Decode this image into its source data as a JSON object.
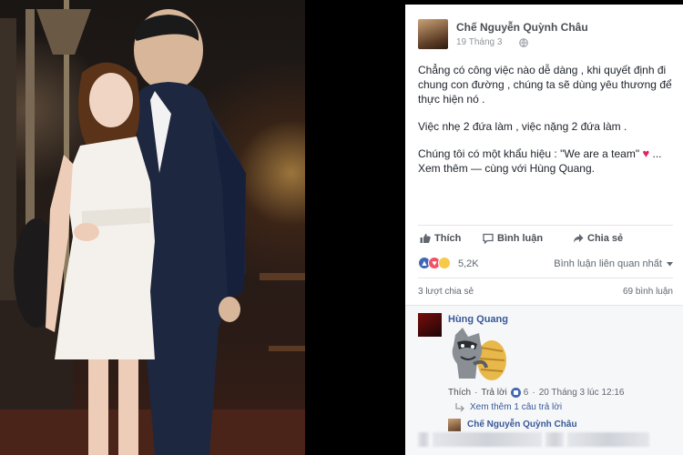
{
  "post": {
    "author": "Chế Nguyễn Quỳnh Châu",
    "time": "19 Tháng 3",
    "text": {
      "p1": "Chẳng có công việc nào dễ dàng , khi quyết định đi chung con đường , chúng ta sẽ dùng yêu thương để thực hiện nó .",
      "p2": "Việc nhẹ 2 đứa làm , việc nặng 2 đứa làm .",
      "p3_prefix": "Chúng tôi có một khẩu hiệu : \"We are a team\"",
      "p3_suffix": " ...",
      "see_more": "Xem thêm — cùng với Hùng Quang."
    },
    "actions": {
      "like": "Thích",
      "comment": "Bình luận",
      "share": "Chia sẻ"
    },
    "reactions": {
      "count": "5,2K",
      "sort_label": "Bình luận liên quan nhất"
    },
    "stats": {
      "shares": "3 lượt chia sẻ",
      "comments": "69 bình luận"
    }
  },
  "comment": {
    "author": "Hùng Quang",
    "like_label": "Thích",
    "reply_label": "Trả lời",
    "likes": "6",
    "time": "20 Tháng 3 lúc 12:16",
    "view_more_replies": "Xem thêm 1 câu trả lời",
    "reply_author": "Chế Nguyễn Quỳnh Châu"
  },
  "colors": {
    "link": "#385898",
    "like_blue": "#4267b2",
    "heart": "#e0245e"
  }
}
